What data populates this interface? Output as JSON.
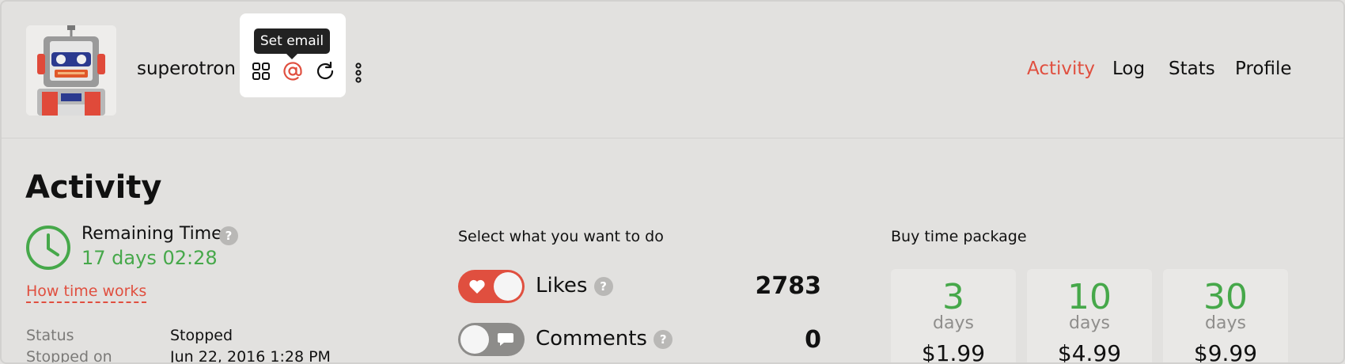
{
  "header": {
    "username": "superotron",
    "tooltip": "Set email",
    "nav": [
      {
        "label": "Activity",
        "active": true
      },
      {
        "label": "Log",
        "active": false
      },
      {
        "label": "Stats",
        "active": false
      },
      {
        "label": "Profile",
        "active": false
      }
    ],
    "toolbar_icons": [
      "grid-icon",
      "at-email-icon",
      "refresh-icon"
    ],
    "menu_icon": "more-vertical-icon"
  },
  "main": {
    "title": "Activity",
    "remaining": {
      "label": "Remaining Time",
      "value": "17 days 02:28",
      "help": "?",
      "how_link": "How time works"
    },
    "status": [
      {
        "label": "Status",
        "value": "Stopped"
      },
      {
        "label": "Stopped on",
        "value": "Jun 22, 2016 1:28 PM"
      }
    ],
    "actions": {
      "heading": "Select what you want to do",
      "items": [
        {
          "label": "Likes",
          "count": "2783",
          "enabled": true,
          "icon": "heart-icon",
          "help": "?"
        },
        {
          "label": "Comments",
          "count": "0",
          "enabled": false,
          "icon": "comment-icon",
          "help": "?"
        }
      ]
    },
    "packages": {
      "heading": "Buy time package",
      "items": [
        {
          "num": "3",
          "unit": "days",
          "price": "$1.99"
        },
        {
          "num": "10",
          "unit": "days",
          "price": "$4.99"
        },
        {
          "num": "30",
          "unit": "days",
          "price": "$9.99"
        }
      ]
    }
  },
  "colors": {
    "accent": "#e04f3f",
    "green": "#46a84a",
    "background": "#e2e1df",
    "toggle_off": "#8d8c8a"
  }
}
